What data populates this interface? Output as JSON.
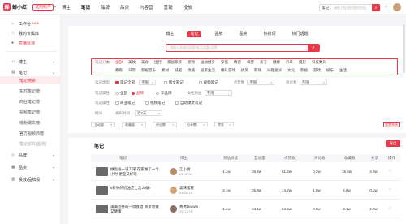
{
  "app": {
    "logo_mark": "蝉",
    "logo_text": "蝉小红",
    "workspace": "试用账户"
  },
  "topnav": {
    "items": [
      "博主",
      "笔记",
      "品牌",
      "品类",
      "内容营",
      "营销",
      "投放"
    ],
    "active": 1
  },
  "top_search": {
    "select": "笔记",
    "placeholder": "请输入您要搜索的内容"
  },
  "sidebar": {
    "top_items": [
      "工作台",
      "我的专属库",
      "直播监测"
    ],
    "new_badge": "NEW",
    "groups": [
      {
        "label": "博主"
      },
      {
        "label": "笔记",
        "subs": [
          "笔记搜索",
          "实时笔记榜",
          "商业笔记榜",
          "视频笔记榜",
          "低粉爆文榜",
          "官方视频商榜",
          "笔记追踪(监测)"
        ]
      },
      {
        "label": "品牌"
      },
      {
        "label": "品类"
      },
      {
        "label": "投放/品牌投"
      }
    ]
  },
  "subtabs": {
    "items": [
      "博主",
      "笔记",
      "品牌",
      "品类",
      "热搜词",
      "热门话题"
    ],
    "active": 1
  },
  "note_search": {
    "placeholder": "请输入关键词搜索笔记/话题/品牌",
    "button_icon": "search-icon"
  },
  "filters": {
    "category": {
      "label": "笔记分类",
      "row1": [
        "全部",
        "美妆",
        "美食",
        "出行",
        "家居家装",
        "宠物",
        "运动健身",
        "穿搭",
        "情感",
        "母婴",
        "亲子",
        "健康",
        "汽车",
        "摄影",
        "科技数码"
      ],
      "row2": [
        "教育",
        "日常",
        "影视音乐",
        "素材",
        "减肥",
        "情感",
        "居家生活",
        "婚礼游戏",
        "搞笑",
        "职场",
        "兴趣爱好",
        "文化",
        "影视",
        "游戏",
        "娱乐",
        "生活"
      ],
      "active": 0
    },
    "note_type": {
      "label": "笔记类型",
      "options": [
        "笔记全部",
        "图文笔记",
        "视频笔记"
      ],
      "checked": 0
    },
    "like_count": {
      "label": "点赞数",
      "value": "不限"
    },
    "fans_count": {
      "label": "粉丝数",
      "value": "不限"
    },
    "brand": {
      "label": "品牌",
      "options": [
        "全部",
        "非品牌",
        "品牌"
      ],
      "selected": 0
    },
    "female_fans": {
      "label": "女性粉丝",
      "value": "不限"
    },
    "other": {
      "label": "笔记属性",
      "options": [
        "商业笔记",
        "视频笔记",
        "自动爆文笔记"
      ]
    },
    "time": {
      "label": "发布时间",
      "value": "近7天"
    },
    "row_labels": [
      "笔记类型",
      "笔记属性",
      "时间"
    ]
  },
  "chips": [
    "互动量",
    "收藏量",
    "评论数",
    "分享数",
    "转发"
  ],
  "reset_label": "重置筛选",
  "table": {
    "title": "笔记",
    "export": "导出",
    "headers": [
      "笔记",
      "博主",
      "预估阅读",
      "互动量",
      "点赞数",
      "评论数",
      "收藏数",
      "分享",
      "操作"
    ],
    "rows": [
      {
        "title": "做饭省一道工序 在家做了一个小时 便宜又好吃",
        "blogger": "江小厨",
        "id": "24101111",
        "c1": "1.1w",
        "c2": "36.4w",
        "c3": "61.2w",
        "c4": "0.2w",
        "c5": "16.5w",
        "c6": "2.9w",
        "c7": "5.4w"
      },
      {
        "title": "5秒钟的奶油芝士怎么做?",
        "blogger": "美味蛋糕",
        "id": "2454411",
        "c1": "2.1w",
        "c2": "36.9w",
        "c3": "14.2w",
        "c4": "1.5w",
        "c5": "4.8w",
        "c6": "0.2w",
        "c7": "1.1w"
      },
      {
        "title": "满满营养的一周食谱 简单易做又健康",
        "blogger": "菁菁Darwin",
        "id": "2217171",
        "c1": "1.1w",
        "c2": "34.1w",
        "c3": "54.5w",
        "c4": "0.5w",
        "c5": "3.1w",
        "c6": "2.0w",
        "c7": "3.4w"
      }
    ]
  },
  "colors": {
    "accent": "#e8394a"
  }
}
